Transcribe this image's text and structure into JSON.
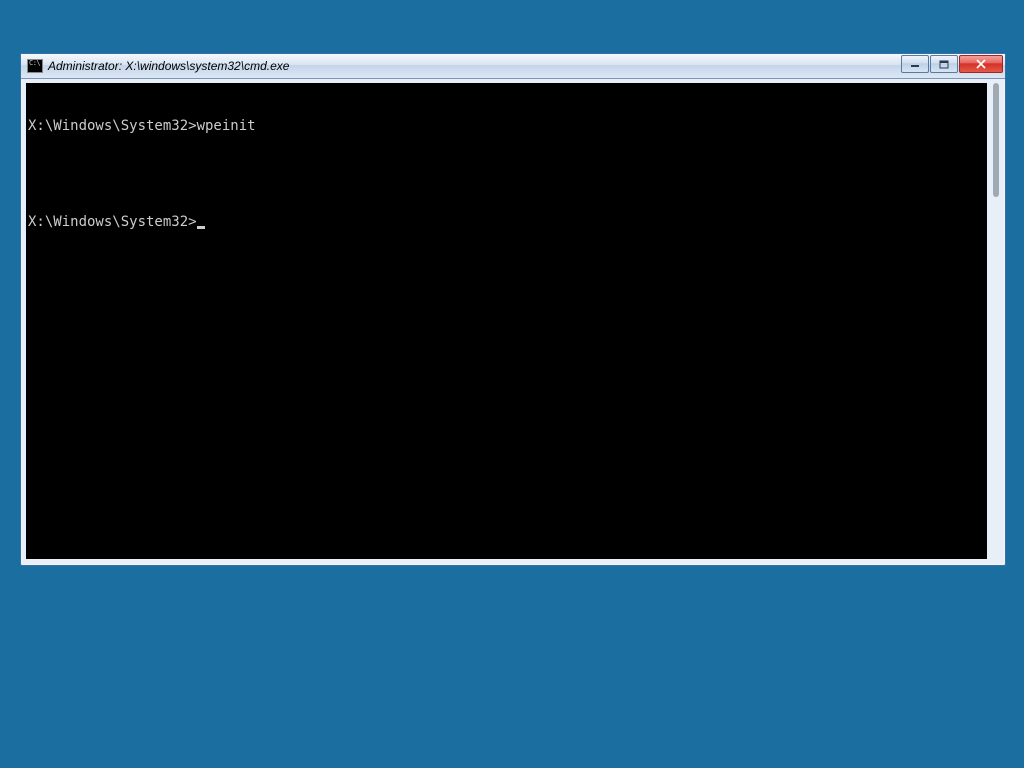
{
  "window": {
    "title": "Administrator: X:\\windows\\system32\\cmd.exe"
  },
  "terminal": {
    "lines": [
      {
        "prompt": "X:\\Windows\\System32>",
        "command": "wpeinit"
      }
    ],
    "current_prompt": "X:\\Windows\\System32>"
  },
  "colors": {
    "desktop_bg": "#1a6ea0",
    "console_bg": "#000000",
    "console_fg": "#cccccc"
  }
}
